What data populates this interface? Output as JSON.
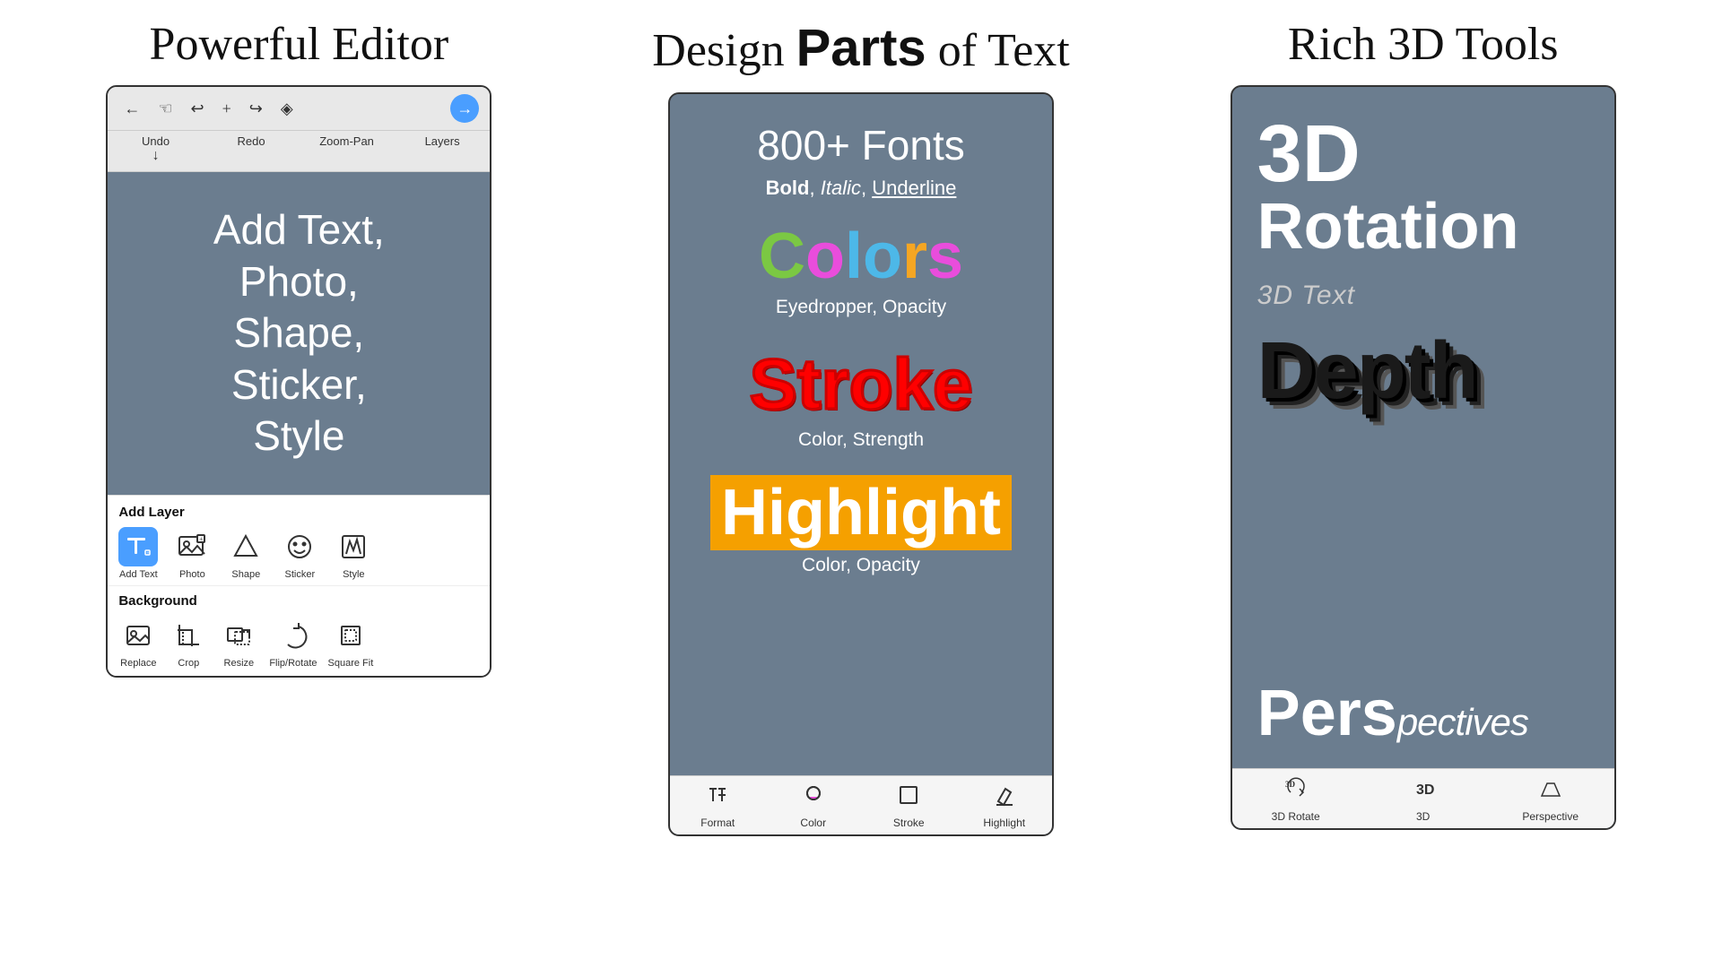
{
  "sections": [
    {
      "id": "section1",
      "title": "Powerful Editor",
      "topbar": {
        "icons": [
          "←",
          "☜",
          "↩",
          "+",
          "↪",
          "◈",
          "→"
        ]
      },
      "toolbar_labels": [
        {
          "label": "Undo",
          "sub": "↓"
        },
        {
          "label": "Redo"
        },
        {
          "label": "Zoom-Pan"
        },
        {
          "label": "Layers"
        }
      ],
      "canvas_text": "Add Text,\nPhoto,\nShape,\nSticker,\nStyle",
      "add_layer_title": "Add Layer",
      "layer_items": [
        {
          "label": "Add Text",
          "active": true
        },
        {
          "label": "Photo"
        },
        {
          "label": "Shape"
        },
        {
          "label": "Sticker"
        },
        {
          "label": "Style"
        }
      ],
      "background_title": "Background",
      "bg_items": [
        {
          "label": "Replace"
        },
        {
          "label": "Crop"
        },
        {
          "label": "Resize"
        },
        {
          "label": "Flip/Rotate"
        },
        {
          "label": "Square Fit"
        }
      ]
    },
    {
      "id": "section2",
      "title_plain": "Design ",
      "title_bold": "Parts",
      "title_end": " of Text",
      "content": {
        "fonts_line": "800+ Fonts",
        "bold_italic_line": "Bold, Italic, Underline",
        "colors_letters": [
          "C",
          "o",
          "l",
          "o",
          "r",
          "s"
        ],
        "colors_colors": [
          "#7bc843",
          "#e94ddc",
          "#4db8e8",
          "#4db8e8",
          "#f5a623",
          "#e94ddc"
        ],
        "eyedropper_line": "Eyedropper, Opacity",
        "stroke_word": "Stroke",
        "stroke_sub": "Color, Strength",
        "highlight_word": "Highlight",
        "highlight_sub": "Color, Opacity"
      },
      "toolbar_items": [
        {
          "label": "Format",
          "icon": "format"
        },
        {
          "label": "Color",
          "icon": "color"
        },
        {
          "label": "Stroke",
          "icon": "stroke"
        },
        {
          "label": "Highlight",
          "icon": "highlight"
        }
      ]
    },
    {
      "id": "section3",
      "title": "Rich 3D Tools",
      "content": {
        "line1": "3D",
        "line2": "Rotation",
        "label_3d_text": "3D Text",
        "depth_word": "Depth",
        "perspectives_word": "Perspectives"
      },
      "toolbar_items": [
        {
          "label": "3D Rotate",
          "icon": "3d-rotate"
        },
        {
          "label": "3D",
          "icon": "3d"
        },
        {
          "label": "Perspective",
          "icon": "perspective"
        }
      ]
    }
  ]
}
